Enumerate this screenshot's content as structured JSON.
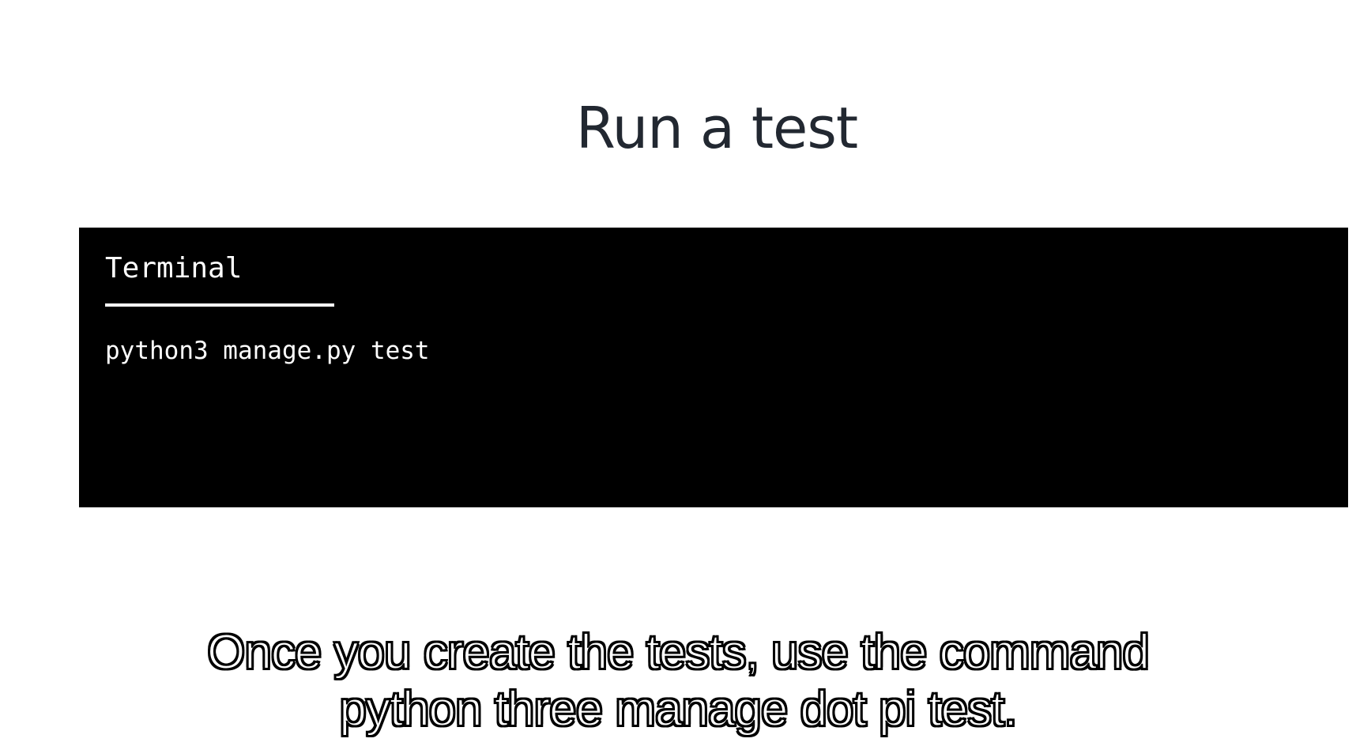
{
  "slide": {
    "title": "Run a test"
  },
  "terminal": {
    "tab_label": "Terminal",
    "command": "python3 manage.py test"
  },
  "caption": {
    "lines": [
      "Once you create the tests, use the command",
      "python three manage dot pi test."
    ]
  },
  "colors": {
    "background": "#ffffff",
    "title": "#222831",
    "terminal_background": "#000000",
    "terminal_text": "#ffffff"
  }
}
